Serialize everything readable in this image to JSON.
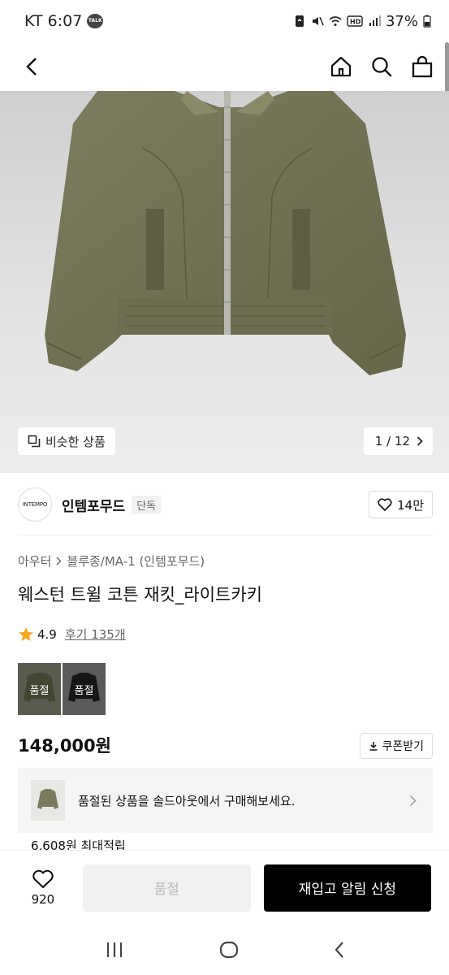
{
  "status_bar": {
    "carrier_time": "KT 6:07",
    "talk_badge": "TALK",
    "battery": "37%",
    "icons": [
      "talk-icon",
      "sync-icon",
      "mute-icon",
      "wifi-icon",
      "hd-icon",
      "signal-icon",
      "battery-icon"
    ]
  },
  "nav": {
    "back_icon": "chevron-left-icon",
    "home_icon": "home-icon",
    "search_icon": "search-icon",
    "cart_icon": "shopping-bag-icon"
  },
  "hero": {
    "similar_label": "비슷한 상품",
    "page_counter": "1 / 12"
  },
  "brand": {
    "logo_text": "INTEMPO",
    "name": "인템포무드",
    "badge": "단독",
    "like_count": "14만"
  },
  "breadcrumb": {
    "category": "아우터",
    "subcategory": "블루종/MA-1 (인템포무드)"
  },
  "product": {
    "title": "웨스턴 트윌 코튼 재킷_라이트카키",
    "rating": "4.9",
    "reviews": "후기 135개",
    "price": "148,000원",
    "coupon_label": "쿠폰받기"
  },
  "variants": [
    {
      "label": "품절",
      "color": "#7a7a5c"
    },
    {
      "label": "품절",
      "color": "#3a3a3a"
    }
  ],
  "soldout_banner": {
    "text": "품절된 상품을 솔드아웃에서 구매해보세요."
  },
  "points": {
    "text": "6,608원 최대적립"
  },
  "bottom_bar": {
    "wishlist_count": "920",
    "soldout_label": "품절",
    "restock_label": "재입고 알림 신청"
  },
  "colors": {
    "accent": "#000000",
    "star": "#f5a623",
    "jacket": "#6f6f52"
  }
}
